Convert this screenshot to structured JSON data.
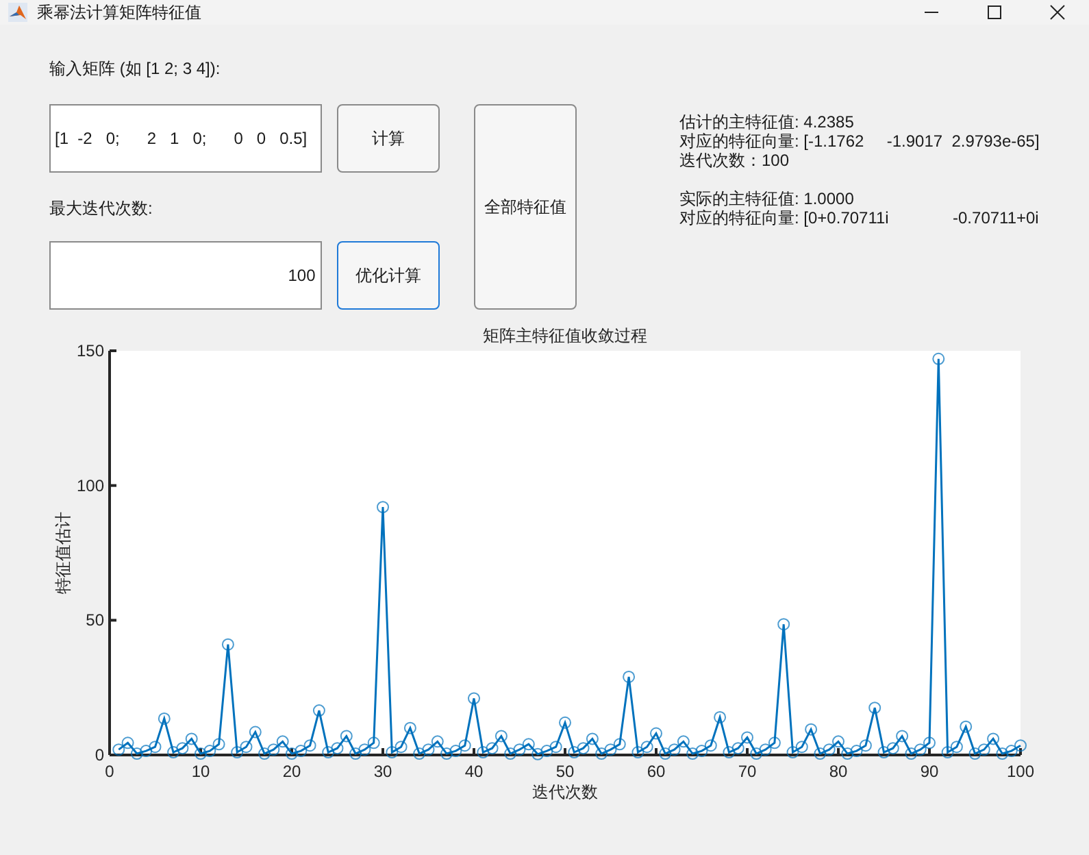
{
  "window": {
    "title": "乘幂法计算矩阵特征值"
  },
  "matrix_label": "输入矩阵 (如 [1 2; 3 4]):",
  "matrix_input": {
    "value": "[1  -2   0;      2   1   0;      0   0   0.5]"
  },
  "compute_button": {
    "label": "计算",
    "focused": false
  },
  "iterations_label": "最大迭代次数:",
  "iterations_input": {
    "value": "100"
  },
  "optimize_button": {
    "label": "优化计算",
    "focused": true
  },
  "all_eigen_button": {
    "label": "全部特征值",
    "focused": false
  },
  "results": [
    {
      "lines": [
        "估计的主特征值: 4.2385",
        "对应的特征向量: [-1.1762     -1.9017  2.9793e-65]",
        "迭代次数：100"
      ]
    },
    {
      "lines": [
        "实际的主特征值: 1.0000",
        "对应的特征向量: [0+0.70711i              -0.70711+0i"
      ]
    }
  ],
  "chart_data": {
    "type": "line",
    "title": "矩阵主特征值收敛过程",
    "xlabel": "迭代次数",
    "ylabel": "特征值估计",
    "xlim": [
      0,
      100
    ],
    "ylim": [
      0,
      150
    ],
    "xticks": [
      0,
      10,
      20,
      30,
      40,
      50,
      60,
      70,
      80,
      90,
      100
    ],
    "yticks": [
      0,
      50,
      100,
      150
    ],
    "x": [
      1,
      2,
      3,
      4,
      5,
      6,
      7,
      8,
      9,
      10,
      11,
      12,
      13,
      14,
      15,
      16,
      17,
      18,
      19,
      20,
      21,
      22,
      23,
      24,
      25,
      26,
      27,
      28,
      29,
      30,
      31,
      32,
      33,
      34,
      35,
      36,
      37,
      38,
      39,
      40,
      41,
      42,
      43,
      44,
      45,
      46,
      47,
      48,
      49,
      50,
      51,
      52,
      53,
      54,
      55,
      56,
      57,
      58,
      59,
      60,
      61,
      62,
      63,
      64,
      65,
      66,
      67,
      68,
      69,
      70,
      71,
      72,
      73,
      74,
      75,
      76,
      77,
      78,
      79,
      80,
      81,
      82,
      83,
      84,
      85,
      86,
      87,
      88,
      89,
      90,
      91,
      92,
      93,
      94,
      95,
      96,
      97,
      98,
      99,
      100
    ],
    "series": [
      {
        "color": "#0072bd",
        "marker": "o",
        "values": [
          2,
          4.5,
          0.5,
          1.5,
          3,
          13.5,
          1,
          2.5,
          6,
          0.5,
          1.5,
          4,
          41,
          1,
          3,
          8.5,
          0.5,
          2,
          5,
          0.5,
          1.5,
          3.5,
          16.5,
          1,
          2.5,
          7,
          0.5,
          2,
          4.5,
          92,
          1,
          3,
          10,
          0.5,
          2,
          5,
          0.5,
          1.5,
          3.5,
          21,
          1,
          2.5,
          7,
          0.5,
          2,
          4,
          0.3,
          1.5,
          3,
          12,
          1,
          2.5,
          6,
          0.5,
          2,
          4,
          29,
          1,
          3,
          8,
          0.5,
          2,
          5,
          0.5,
          1.5,
          3.5,
          14,
          1,
          2.5,
          6.5,
          0.5,
          2,
          4.5,
          48.5,
          1,
          3,
          9.5,
          0.5,
          2,
          5,
          0.5,
          1.5,
          3.5,
          17.5,
          1,
          2.5,
          7,
          0.5,
          2,
          4.5,
          147,
          1,
          3,
          10.5,
          0.5,
          2,
          6,
          0.5,
          1.5,
          3.5
        ]
      }
    ]
  }
}
